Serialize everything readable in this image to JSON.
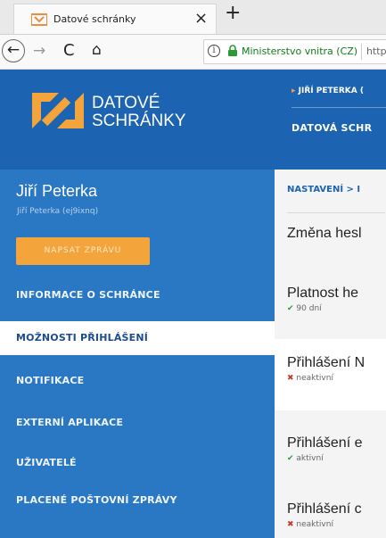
{
  "browser": {
    "tab_title": "Datové schránky",
    "close_glyph": "×",
    "new_tab_glyph": "+",
    "back_glyph": "←",
    "forward_glyph": "→",
    "reload_glyph": "C",
    "home_glyph": "⌂",
    "site_identity": "Ministerstvo vnitra (CZ)",
    "url_partial": "http"
  },
  "header": {
    "logo_line1": "DATOVÉ",
    "logo_line2": "SCHRÁNKY",
    "user_line": "JIŘÍ PETERKA (",
    "user_arrow": "▸",
    "app_title": "DATOVÁ SCHR"
  },
  "sidebar": {
    "user_name": "Jiří Peterka",
    "user_sub": "Jiří Peterka (ej9ixnq)",
    "compose_label": "NAPSAT ZPRÁVU",
    "items": [
      {
        "label": "INFORMACE O SCHRÁNCE"
      },
      {
        "label": "MOŽNOSTI PŘIHLÁŠENÍ"
      },
      {
        "label": "NOTIFIKACE"
      },
      {
        "label": "EXTERNÍ APLIKACE"
      },
      {
        "label": "UŽIVATELÉ"
      },
      {
        "label": "PLACENÉ POŠTOVNÍ ZPRÁVY"
      }
    ]
  },
  "content": {
    "breadcrumb": "NASTAVENÍ > I",
    "section_title": "Změna hesl",
    "items": [
      {
        "title": "Platnost he",
        "mark": "✔",
        "status": "90 dní"
      },
      {
        "title": "Přihlášení N",
        "mark": "✖",
        "status": "neaktivní"
      },
      {
        "title": "Přihlášení e",
        "mark": "✔",
        "status": "aktivní"
      },
      {
        "title": "Přihlášení c",
        "mark": "✖",
        "status": "neaktivní"
      }
    ]
  },
  "colors": {
    "header_blue": "#1c64b2",
    "sidebar_blue": "#2a77c4",
    "accent_orange": "#f3a53b",
    "ok_green": "#2e9a3a",
    "bad_red": "#c43a2a"
  }
}
